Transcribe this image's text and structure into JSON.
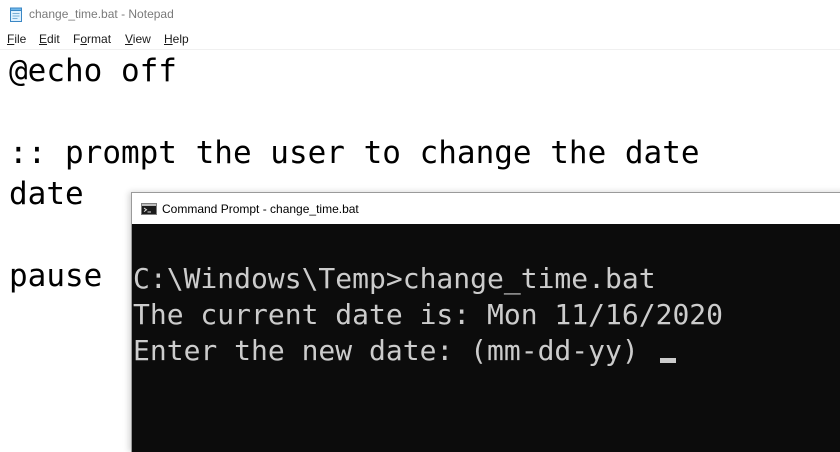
{
  "notepad": {
    "title": "change_time.bat - Notepad",
    "icon": "notepad-icon",
    "menu": [
      {
        "label": "File",
        "mnemonic": "F",
        "rest": "ile"
      },
      {
        "label": "Edit",
        "mnemonic": "E",
        "rest": "dit"
      },
      {
        "label": "Format",
        "mnemonic": "o",
        "pre": "F",
        "rest": "rmat"
      },
      {
        "label": "View",
        "mnemonic": "V",
        "rest": "iew"
      },
      {
        "label": "Help",
        "mnemonic": "H",
        "rest": "elp"
      }
    ],
    "lines": [
      "@echo off",
      "",
      ":: prompt the user to change the date",
      "date",
      "",
      "pause"
    ]
  },
  "cmd": {
    "title": "Command Prompt - change_time.bat",
    "icon": "command-prompt-icon",
    "lines": [
      "",
      "C:\\Windows\\Temp>change_time.bat",
      "The current date is: Mon 11/16/2020",
      "Enter the new date: (mm-dd-yy) "
    ],
    "colors": {
      "background": "#0c0c0c",
      "text": "#cccccc"
    }
  }
}
